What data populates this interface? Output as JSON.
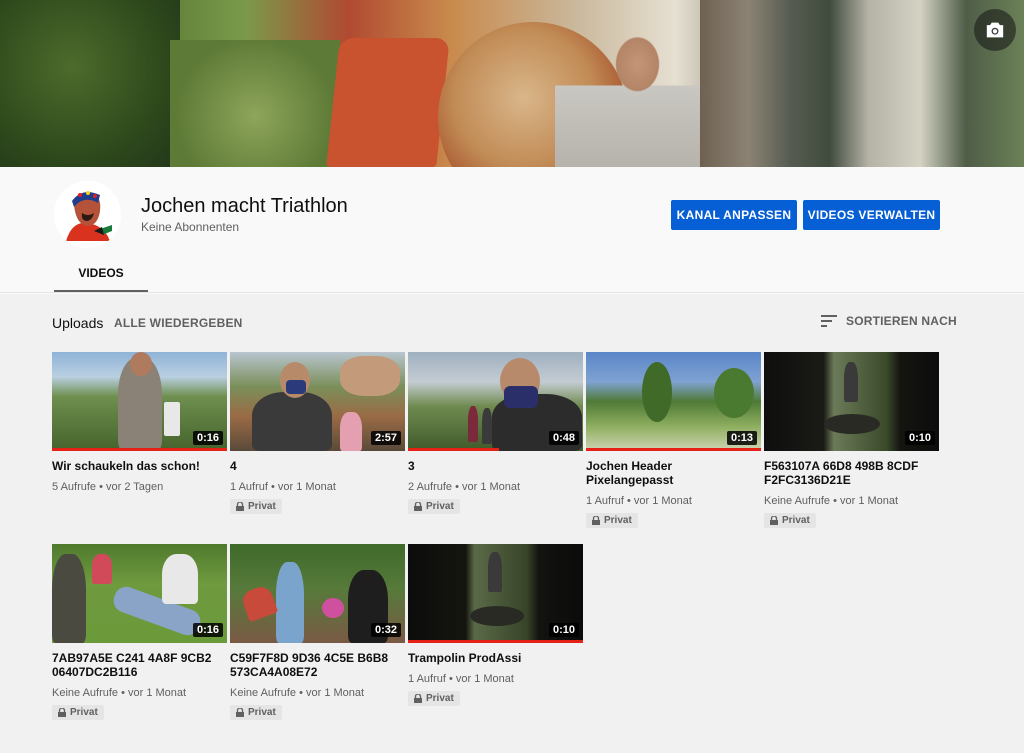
{
  "channel": {
    "name": "Jochen macht Triathlon",
    "subscribers": "Keine Abonnenten",
    "customize_label": "KANAL ANPASSEN",
    "manage_label": "VIDEOS VERWALTEN"
  },
  "tabs": {
    "videos": "VIDEOS"
  },
  "uploads": {
    "title": "Uploads",
    "play_all": "ALLE WIEDERGEBEN",
    "sort_label": "SORTIEREN NACH"
  },
  "videos": [
    {
      "title": "Wir schaukeln das schon!",
      "duration": "0:16",
      "meta": "5 Aufrufe • vor 2 Tagen",
      "private": ""
    },
    {
      "title": "4",
      "duration": "2:57",
      "meta": "1 Aufruf • vor 1 Monat",
      "private": "Privat"
    },
    {
      "title": "3",
      "duration": "0:48",
      "meta": "2 Aufrufe • vor 1 Monat",
      "private": "Privat"
    },
    {
      "title": "Jochen Header Pixelangepasst",
      "duration": "0:13",
      "meta": "1 Aufruf • vor 1 Monat",
      "private": "Privat"
    },
    {
      "title": "F563107A 66D8 498B 8CDF F2FC3136D21E",
      "duration": "0:10",
      "meta": "Keine Aufrufe • vor 1 Monat",
      "private": "Privat"
    },
    {
      "title": "7AB97A5E C241 4A8F 9CB2 06407DC2B116",
      "duration": "0:16",
      "meta": "Keine Aufrufe • vor 1 Monat",
      "private": "Privat"
    },
    {
      "title": "C59F7F8D 9D36 4C5E B6B8 573CA4A08E72",
      "duration": "0:32",
      "meta": "Keine Aufrufe • vor 1 Monat",
      "private": "Privat"
    },
    {
      "title": "Trampolin ProdAssi",
      "duration": "0:10",
      "meta": "1 Aufruf • vor 1 Monat",
      "private": "Privat"
    }
  ],
  "icons": {
    "camera": "camera-icon",
    "sort": "sort-icon",
    "lock": "lock-icon"
  },
  "colors": {
    "accent": "#065fd4",
    "progress": "#e62117"
  }
}
